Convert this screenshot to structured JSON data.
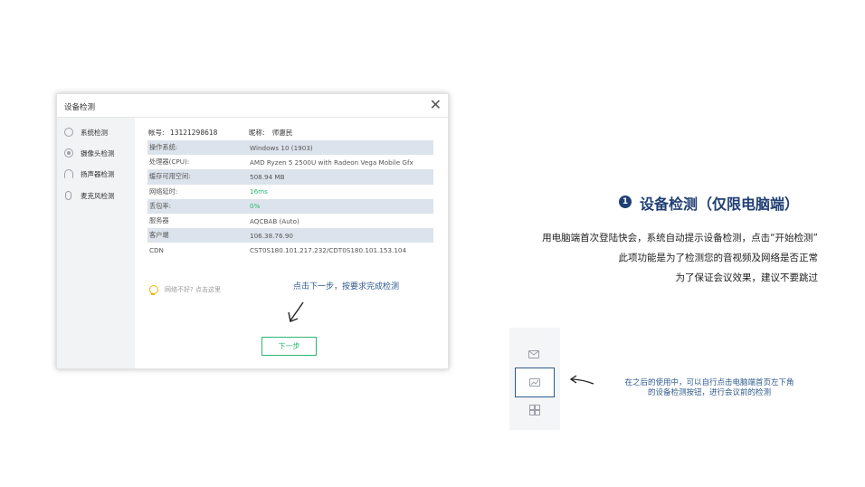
{
  "dialog": {
    "title": "设备检测",
    "close": "✕",
    "sidebar": [
      {
        "label": "系统检测",
        "icon": "globe-icon"
      },
      {
        "label": "摄像头检测",
        "icon": "camera-icon"
      },
      {
        "label": "扬声器检测",
        "icon": "headphones-icon"
      },
      {
        "label": "麦克风检测",
        "icon": "microphone-icon"
      }
    ],
    "account_label": "帐号:",
    "account_value": "13121298618",
    "nickname_label": "昵称:",
    "nickname_value": "师惠民",
    "rows": [
      {
        "key": "操作系统:",
        "value": "Windows 10 (1903)"
      },
      {
        "key": "处理器(CPU):",
        "value": "AMD Ryzen 5 2500U with Radeon Vega Mobile Gfx"
      },
      {
        "key": "缓存可用空间:",
        "value": "508.94 MB"
      },
      {
        "key": "网络延时:",
        "value": "16ms"
      },
      {
        "key": "丢包率:",
        "value": "0%"
      },
      {
        "key": "服务器",
        "value": "AQCBAB (Auto)"
      },
      {
        "key": "客户端",
        "value": "106.38.76.90"
      },
      {
        "key": "CDN",
        "value": "CST0S180.101.217.232/CDT0S180.101.153.104"
      }
    ],
    "net_tip": "网络不好? 点击这里",
    "annotation": "点击下一步，按要求完成检测",
    "next_button": "下一步"
  },
  "right": {
    "badge": "1",
    "title": "设备检测（仅限电脑端）",
    "desc1": "用电脑端首次登陆快会，系统自动提示设备检测，点击“开始检测”",
    "desc2": "此项功能是为了检测您的音视频及网络是否正常",
    "desc3": "为了保证会议效果，建议不要跳过",
    "annot_line1": "在之后的使用中，可以自行点击电脑端首页左下角",
    "annot_line2": "的设备检测按钮，进行会议前的检测"
  },
  "colors": {
    "accent_green": "#2bb673",
    "title_blue": "#1f3f73",
    "annotation_blue": "#2f5a8c",
    "row_highlight": "#dde3ec"
  }
}
